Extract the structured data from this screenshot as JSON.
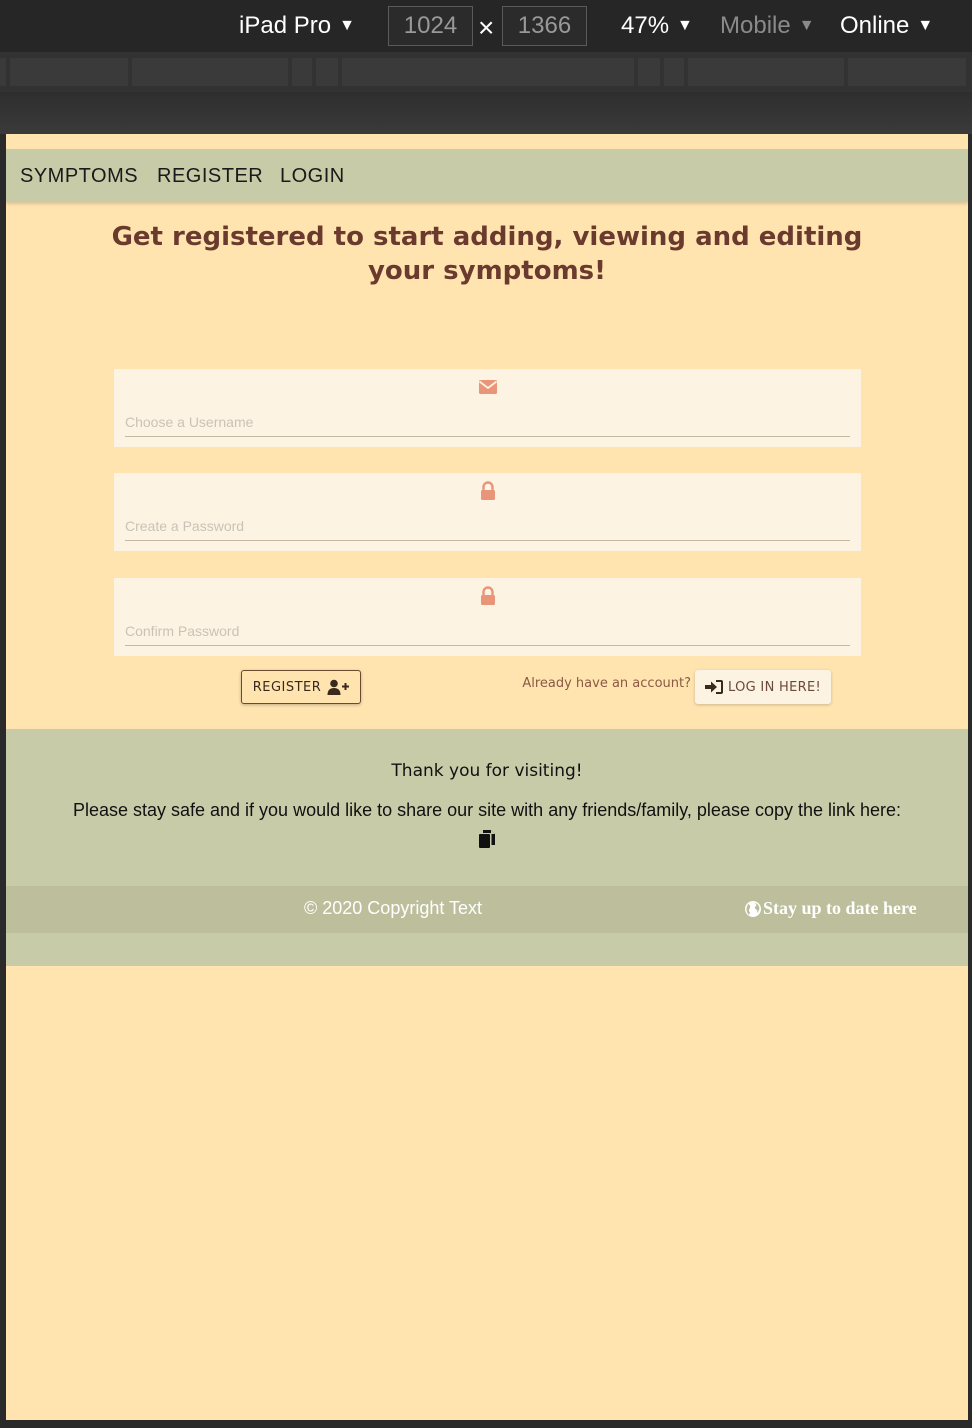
{
  "devtools": {
    "device": "iPad Pro",
    "width": "1024",
    "height": "1366",
    "times": "×",
    "zoom": "47%",
    "throttle_mode": "Mobile",
    "network": "Online"
  },
  "nav": {
    "items": [
      "SYMPTOMS",
      "REGISTER",
      "LOGIN"
    ]
  },
  "page": {
    "headline": "Get registered to start adding, viewing and editing your symptoms!"
  },
  "form": {
    "fields": [
      {
        "icon": "envelope-icon",
        "placeholder": "Choose a Username"
      },
      {
        "icon": "lock-icon",
        "placeholder": "Create a Password"
      },
      {
        "icon": "lock-icon",
        "placeholder": "Confirm Password"
      }
    ],
    "register_label": "REGISTER",
    "already_text": "Already have an account?",
    "login_label": "LOG IN HERE!"
  },
  "footer": {
    "thanks": "Thank you for visiting!",
    "share_text": "Please stay safe and if you would like to share our site with any friends/family, please copy the link here:",
    "copyright": "© 2020 Copyright Text",
    "stay_link": "Stay up to date here"
  },
  "colors": {
    "page_bg": "#ffe4b0",
    "nav_bg": "#c8cba7",
    "headline": "#6b3a2e",
    "icon_accent": "#e8957a"
  }
}
